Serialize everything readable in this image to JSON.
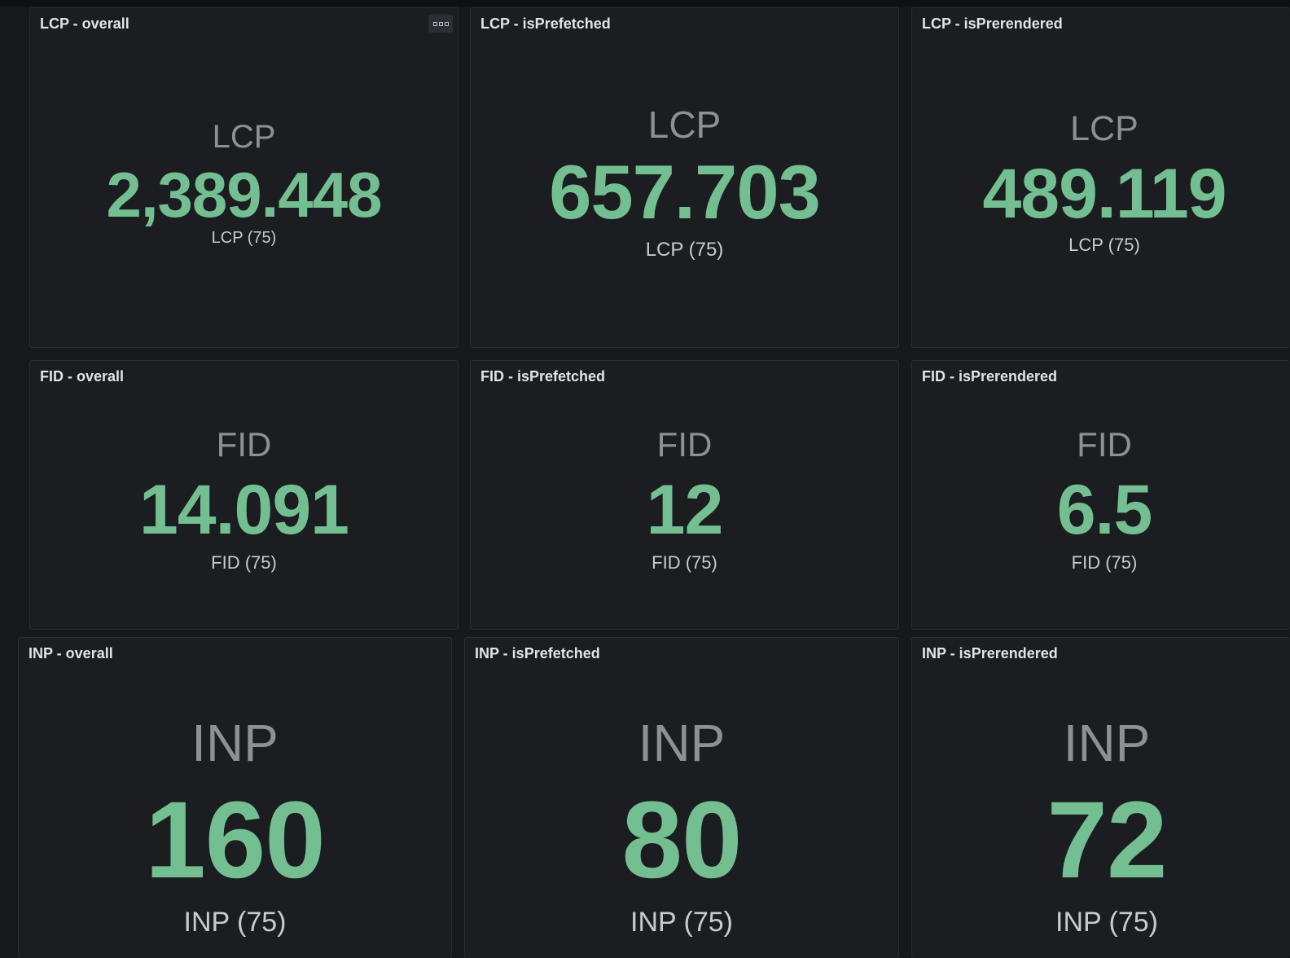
{
  "colors": {
    "background": "#17181b",
    "panel": "#1c1d21",
    "value": "#73bf92",
    "label": "#8e9096",
    "title": "#e2e3e6"
  },
  "icons": {
    "panel_menu": "ellipsis-menu-icon"
  },
  "panels": [
    {
      "title": "LCP - overall",
      "label": "LCP",
      "value": "2,389.448",
      "sublabel": "LCP (75)"
    },
    {
      "title": "LCP - isPrefetched",
      "label": "LCP",
      "value": "657.703",
      "sublabel": "LCP (75)"
    },
    {
      "title": "LCP - isPrerendered",
      "label": "LCP",
      "value": "489.119",
      "sublabel": "LCP (75)"
    },
    {
      "title": "FID - overall",
      "label": "FID",
      "value": "14.091",
      "sublabel": "FID (75)"
    },
    {
      "title": "FID - isPrefetched",
      "label": "FID",
      "value": "12",
      "sublabel": "FID (75)"
    },
    {
      "title": "FID - isPrerendered",
      "label": "FID",
      "value": "6.5",
      "sublabel": "FID (75)"
    },
    {
      "title": "INP - overall",
      "label": "INP",
      "value": "160",
      "sublabel": "INP (75)"
    },
    {
      "title": "INP - isPrefetched",
      "label": "INP",
      "value": "80",
      "sublabel": "INP (75)"
    },
    {
      "title": "INP - isPrerendered",
      "label": "INP",
      "value": "72",
      "sublabel": "INP (75)"
    }
  ]
}
